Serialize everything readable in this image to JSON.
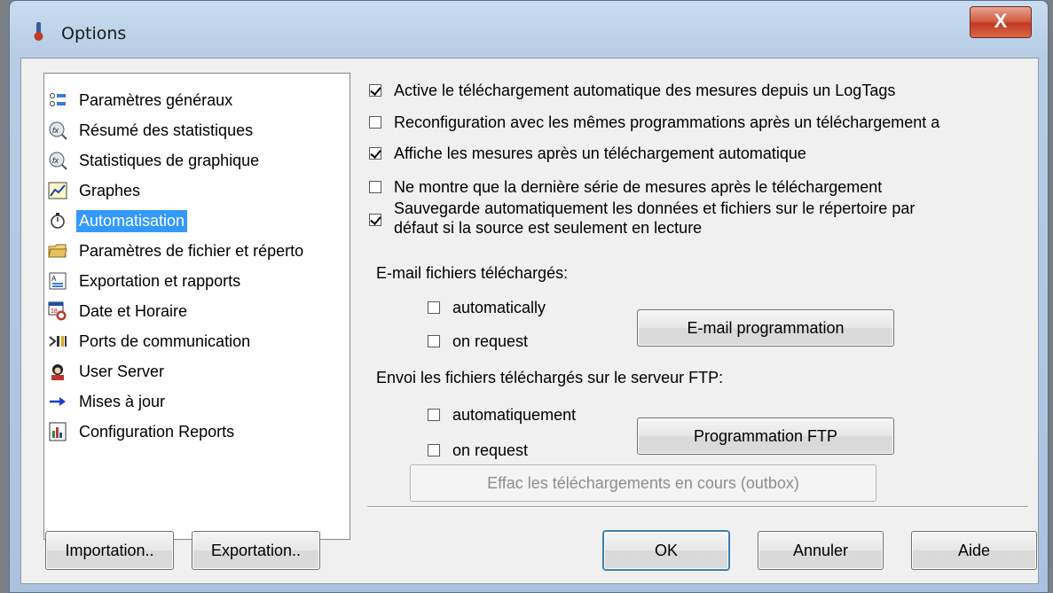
{
  "window": {
    "title": "Options",
    "close_glyph": "X"
  },
  "tree": {
    "items": [
      {
        "label": "Paramètres généraux",
        "icon": "settings-list-icon"
      },
      {
        "label": "Résumé des statistiques",
        "icon": "function-magnifier-icon"
      },
      {
        "label": "Statistiques de graphique",
        "icon": "function-magnifier-icon"
      },
      {
        "label": "Graphes",
        "icon": "graph-line-icon"
      },
      {
        "label": "Automatisation",
        "icon": "stopwatch-icon",
        "selected": true
      },
      {
        "label": "Paramètres de fichier et réperto",
        "icon": "folder-icon"
      },
      {
        "label": "Exportation et rapports",
        "icon": "report-icon"
      },
      {
        "label": "Date et Horaire",
        "icon": "calendar-clock-icon"
      },
      {
        "label": "Ports de communication",
        "icon": "ports-icon"
      },
      {
        "label": "User Server",
        "icon": "user-server-icon"
      },
      {
        "label": "Mises à jour",
        "icon": "arrow-right-icon"
      },
      {
        "label": "Configuration Reports",
        "icon": "config-report-icon"
      }
    ]
  },
  "options": [
    {
      "label": "Active le téléchargement automatique des mesures depuis un LogTags",
      "checked": true
    },
    {
      "label": "Reconfiguration avec les mêmes programmations après un téléchargement a",
      "checked": false
    },
    {
      "label": "Affiche les mesures après un téléchargement automatique",
      "checked": true
    },
    {
      "label": "Ne montre que la dernière série de mesures après le téléchargement",
      "checked": false
    },
    {
      "label_line1": "Sauvegarde automatiquement les données et fichiers sur le répertoire par",
      "label_line2": "défaut si la source est seulement en lecture",
      "checked": true
    }
  ],
  "email": {
    "heading": "E-mail fichiers téléchargés:",
    "automatically": {
      "label": "automatically",
      "checked": false
    },
    "on_request": {
      "label": "on request",
      "checked": false
    },
    "button": "E-mail programmation"
  },
  "ftp": {
    "heading": "Envoi les fichiers téléchargés sur le serveur  FTP:",
    "automatically": {
      "label": "automatiquement",
      "checked": false
    },
    "on_request": {
      "label": "on request",
      "checked": false
    },
    "button": "Programmation FTP"
  },
  "outbox_button": "Effac les téléchargements en cours (outbox)",
  "footer": {
    "import": "Importation..",
    "export": "Exportation..",
    "ok": "OK",
    "cancel": "Annuler",
    "help": "Aide"
  }
}
